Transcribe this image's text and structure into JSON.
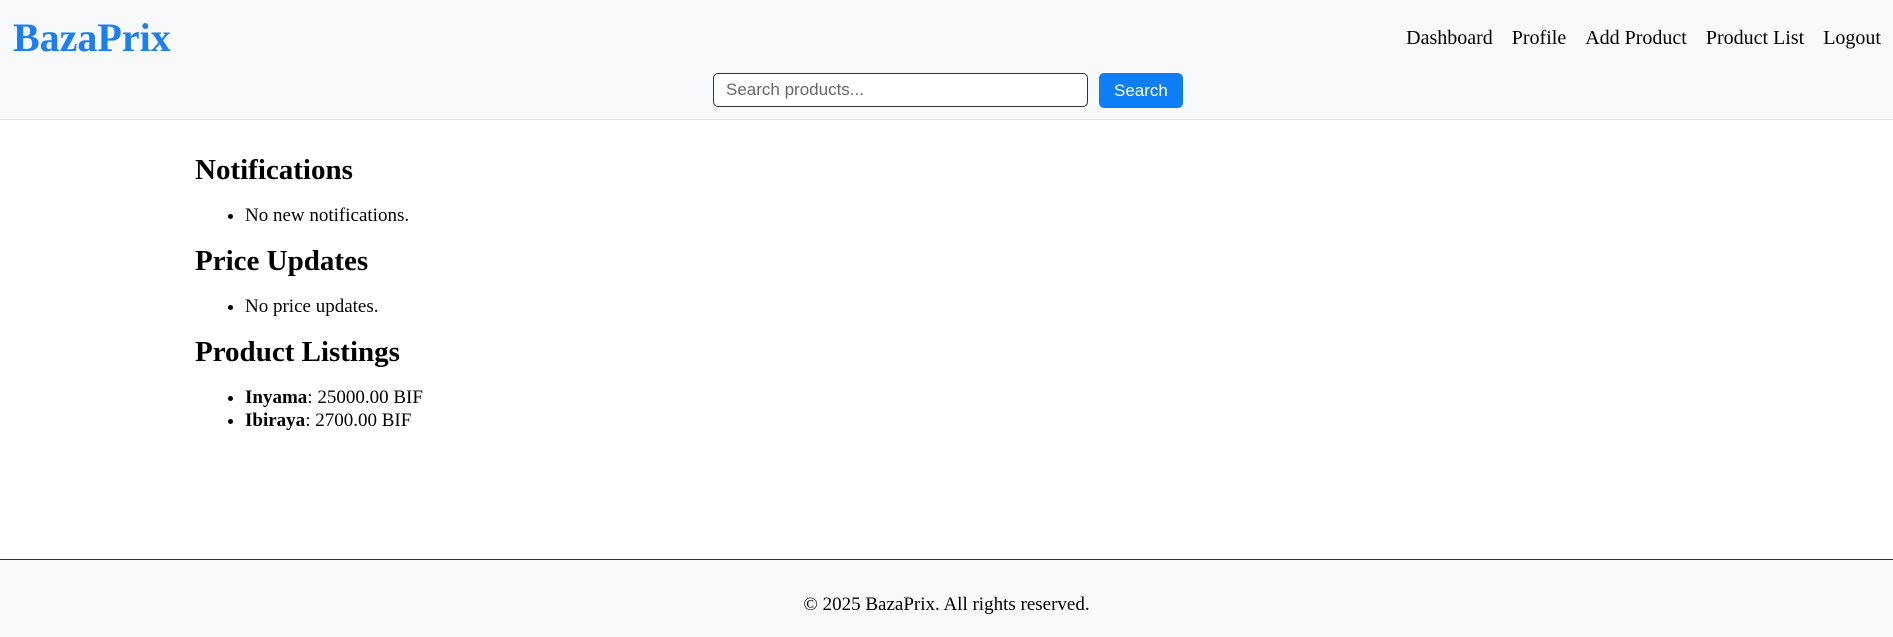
{
  "brand": {
    "name": "BazaPrix",
    "color": "#1a7ff5"
  },
  "nav": {
    "items": [
      "Dashboard",
      "Profile",
      "Add Product",
      "Product List",
      "Logout"
    ]
  },
  "search": {
    "placeholder": "Search products...",
    "button_label": "Search",
    "button_color": "#0d7ef6"
  },
  "sections": {
    "notifications": {
      "title": "Notifications",
      "items": [
        "No new notifications."
      ]
    },
    "price_updates": {
      "title": "Price Updates",
      "items": [
        "No price updates."
      ]
    },
    "product_listings": {
      "title": "Product Listings",
      "items": [
        {
          "name": "Inyama",
          "price": ": 25000.00 BIF"
        },
        {
          "name": "Ibiraya",
          "price": ": 2700.00 BIF"
        }
      ]
    }
  },
  "footer": {
    "text": "© 2025 BazaPrix. All rights reserved."
  }
}
